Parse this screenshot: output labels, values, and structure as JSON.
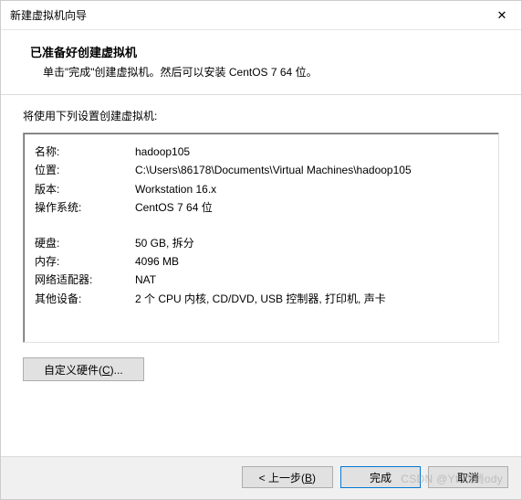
{
  "titlebar": {
    "title": "新建虚拟机向导",
    "close_label": "✕"
  },
  "header": {
    "heading": "已准备好创建虚拟机",
    "subtext": "单击\"完成\"创建虚拟机。然后可以安装 CentOS 7 64 位。"
  },
  "content": {
    "intro": "将使用下列设置创建虚拟机:"
  },
  "summary": {
    "rows1": [
      {
        "label": "名称:",
        "value": "hadoop105"
      },
      {
        "label": "位置:",
        "value": "C:\\Users\\86178\\Documents\\Virtual Machines\\hadoop105"
      },
      {
        "label": "版本:",
        "value": "Workstation 16.x"
      },
      {
        "label": "操作系统:",
        "value": "CentOS 7 64 位"
      }
    ],
    "rows2": [
      {
        "label": "硬盘:",
        "value": "50 GB, 拆分"
      },
      {
        "label": "内存:",
        "value": "4096 MB"
      },
      {
        "label": "网络适配器:",
        "value": "NAT"
      },
      {
        "label": "其他设备:",
        "value": "2 个 CPU 内核, CD/DVD, USB 控制器, 打印机, 声卡"
      }
    ]
  },
  "buttons": {
    "customize_pre": "自定义硬件(",
    "customize_key": "C",
    "customize_post": ")...",
    "back_pre": "< 上一步(",
    "back_key": "B",
    "back_post": ")",
    "finish": "完成",
    "cancel": "取消"
  },
  "watermark": "CSDN @Yt.取消ody"
}
